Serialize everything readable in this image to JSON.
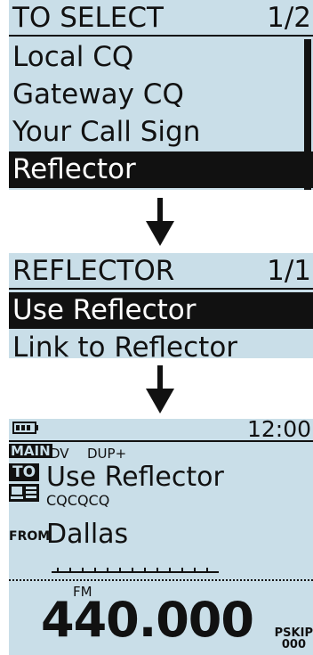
{
  "screen1": {
    "title": "TO SELECT",
    "page": "1/2",
    "items": [
      "Local CQ",
      "Gateway CQ",
      "Your Call Sign",
      "Reflector"
    ],
    "selected_index": 3
  },
  "screen2": {
    "title": "REFLECTOR",
    "page": "1/1",
    "items": [
      "Use Reflector",
      "Link to Reflector"
    ],
    "selected_index": 0
  },
  "screen3": {
    "time": "12:00",
    "band": "MAIN",
    "mode": "DV",
    "duplex": "DUP+",
    "to_label": "TO",
    "to_value": "Use Reflector",
    "to_sub": "CQCQCQ",
    "from_label": "FROM",
    "from_value": "Dallas",
    "fm_label": "FM",
    "frequency": "440.000",
    "pskip": "PSKIP",
    "channel": "000"
  },
  "colors": {
    "lcd": "#c9dee8",
    "ink": "#111111"
  }
}
